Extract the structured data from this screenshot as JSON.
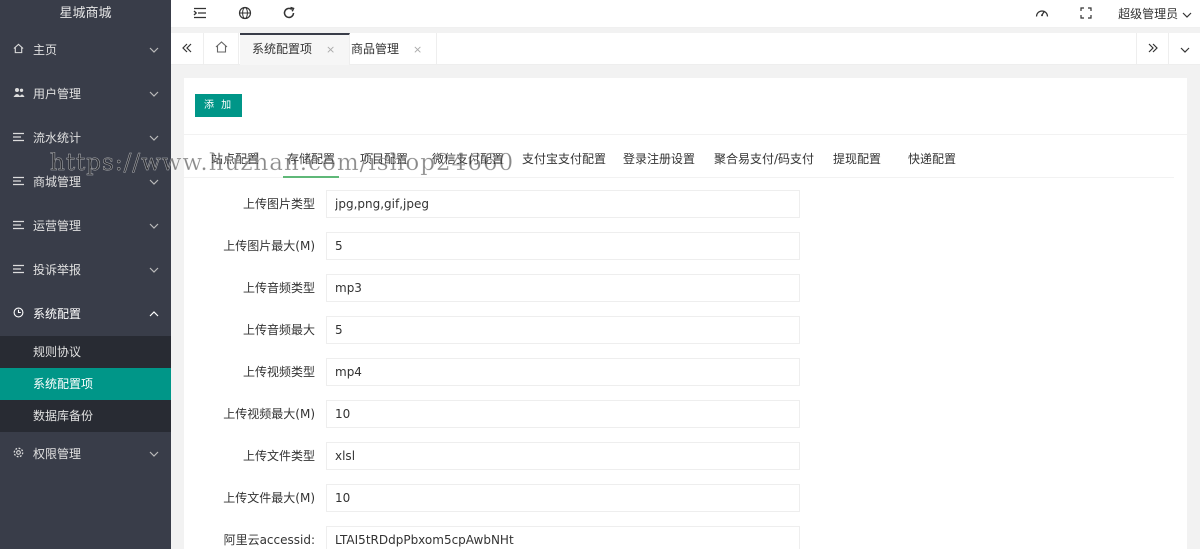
{
  "sidebar": {
    "logo": "星城商城",
    "items": [
      {
        "label": "主页",
        "icon": "home-icon"
      },
      {
        "label": "用户管理",
        "icon": "users-icon"
      },
      {
        "label": "流水统计",
        "icon": "list-icon"
      },
      {
        "label": "商城管理",
        "icon": "list-icon"
      },
      {
        "label": "运营管理",
        "icon": "list-icon"
      },
      {
        "label": "投诉举报",
        "icon": "list-icon"
      },
      {
        "label": "系统配置",
        "icon": "settings-icon"
      },
      {
        "label": "权限管理",
        "icon": "gear-icon"
      }
    ],
    "subitems": [
      "规则协议",
      "系统配置项",
      "数据库备份"
    ]
  },
  "header": {
    "admin_label": "超级管理员"
  },
  "tabs": [
    "系统配置项",
    "商品管理"
  ],
  "toolbar": {
    "add_label": "添 加"
  },
  "config_tabs": [
    "站点配置",
    "存储配置",
    "项目配置",
    "微信支付配置",
    "支付宝支付配置",
    "登录注册设置",
    "聚合易支付/码支付",
    "提现配置",
    "快递配置"
  ],
  "form": [
    {
      "label": "上传图片类型",
      "value": "jpg,png,gif,jpeg"
    },
    {
      "label": "上传图片最大(M)",
      "value": "5"
    },
    {
      "label": "上传音频类型",
      "value": "mp3"
    },
    {
      "label": "上传音频最大",
      "value": "5"
    },
    {
      "label": "上传视频类型",
      "value": "mp4"
    },
    {
      "label": "上传视频最大(M)",
      "value": "10"
    },
    {
      "label": "上传文件类型",
      "value": "xlsl"
    },
    {
      "label": "上传文件最大(M)",
      "value": "10"
    },
    {
      "label": "阿里云accessid:",
      "value": "LTAI5tRDdpPbxom5cpAwbNHt"
    }
  ],
  "watermark": "https://www.huzhan.com/ishop24660",
  "colors": {
    "accent": "#009688",
    "sidebar": "#393d49",
    "active_tab_underline": "#5FB878"
  }
}
